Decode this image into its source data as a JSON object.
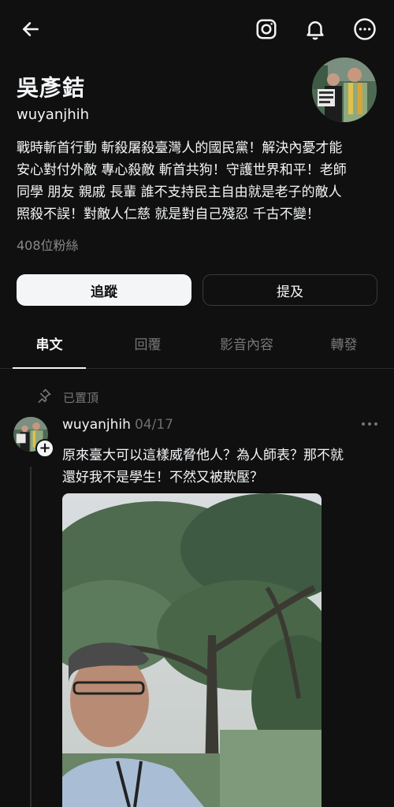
{
  "header": {
    "back_icon": "arrow-left-icon",
    "instagram_icon": "instagram-icon",
    "notification_icon": "bell-icon",
    "more_icon": "more-circle-icon"
  },
  "profile": {
    "name": "吳彥銡",
    "handle": "wuyanjhih",
    "bio_lines": [
      "戰時斬首行動 斬殺屠殺臺灣人的國民黨！解決內憂才能",
      "安心對付外敵 專心殺敵 斬首共狗！守護世界和平！老師",
      "同學 朋友 親戚 長輩 誰不支持民主自由就是老子的敵人",
      "照殺不誤！對敵人仁慈 就是對自己殘忍 千古不變！"
    ],
    "followers": "408位粉絲",
    "follow_label": "追蹤",
    "mention_label": "提及"
  },
  "tabs": [
    {
      "label": "串文",
      "active": true
    },
    {
      "label": "回覆",
      "active": false
    },
    {
      "label": "影音內容",
      "active": false
    },
    {
      "label": "轉發",
      "active": false
    }
  ],
  "post": {
    "pinned_label": "已置頂",
    "username": "wuyanjhih",
    "date": "04/17",
    "text_lines": [
      "原來臺大可以這樣威脅他人？為人師表？那不就",
      "還好我不是學生！不然又被欺壓？"
    ]
  },
  "colors": {
    "background": "#101010",
    "text_primary": "#f3f5f7",
    "text_secondary": "#777777",
    "divider": "#2b2b2b"
  }
}
